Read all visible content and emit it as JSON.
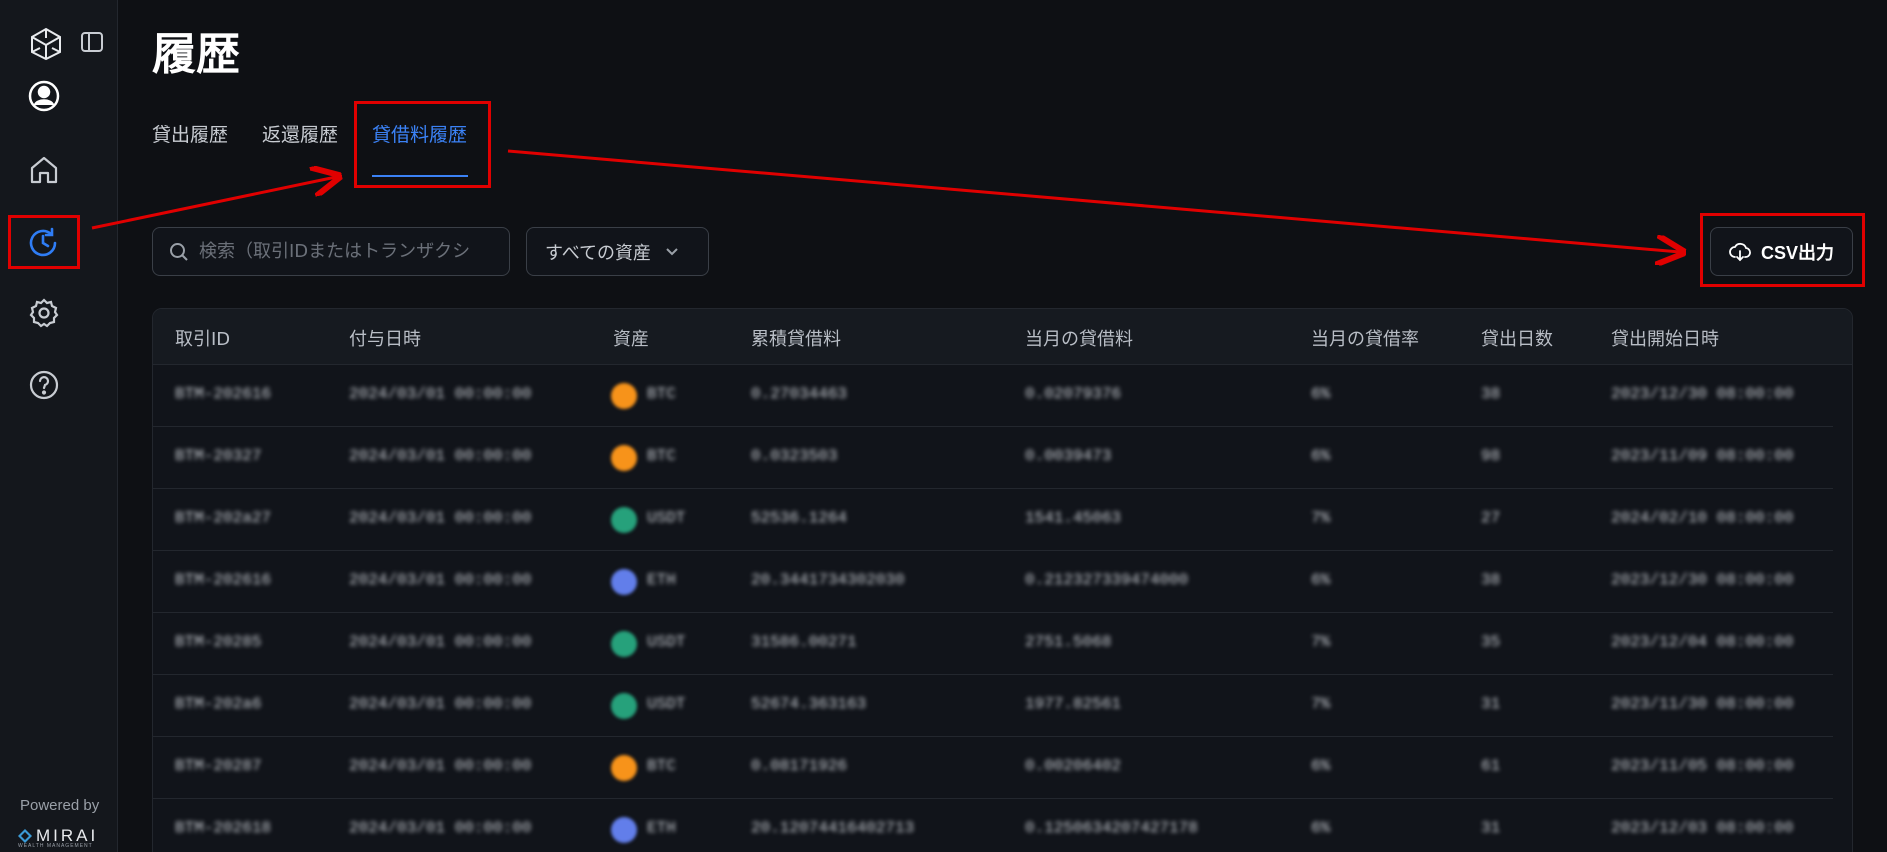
{
  "sidebar": {
    "powered_by": "Powered by",
    "brand": "MIRAI",
    "brand_sub": "WEALTH MANAGEMENT"
  },
  "page": {
    "title": "履歴"
  },
  "tabs": [
    {
      "label": "貸出履歴",
      "active": false
    },
    {
      "label": "返還履歴",
      "active": false
    },
    {
      "label": "貸借料履歴",
      "active": true
    }
  ],
  "search": {
    "placeholder": "検索（取引IDまたはトランザクシ"
  },
  "asset_filter": {
    "selected": "すべての資産"
  },
  "csv_button": {
    "label": "CSV出力"
  },
  "table": {
    "headers": [
      "取引ID",
      "付与日時",
      "資産",
      "累積貸借料",
      "当月の貸借料",
      "当月の貸借率",
      "貸出日数",
      "貸出開始日時"
    ],
    "rows": [
      {
        "id": "BTM-202616",
        "date": "2024/03/01 00:00:00",
        "asset": "BTC",
        "coin_color": "#f7931a",
        "cumulative": "0.27034463",
        "monthly": "0.02079376",
        "rate": "6%",
        "days": "38",
        "start": "2023/12/30 08:00:00"
      },
      {
        "id": "BTM-20327",
        "date": "2024/03/01 00:00:00",
        "asset": "BTC",
        "coin_color": "#f7931a",
        "cumulative": "0.0323503",
        "monthly": "0.0039473",
        "rate": "6%",
        "days": "98",
        "start": "2023/11/09 08:00:00"
      },
      {
        "id": "BTM-202a27",
        "date": "2024/03/01 00:00:00",
        "asset": "USDT",
        "coin_color": "#26a17b",
        "cumulative": "52536.1264",
        "monthly": "1541.45063",
        "rate": "7%",
        "days": "27",
        "start": "2024/02/10 08:00:00"
      },
      {
        "id": "BTM-202616",
        "date": "2024/03/01 00:00:00",
        "asset": "ETH",
        "coin_color": "#627eea",
        "cumulative": "20.3441734302030",
        "monthly": "0.212327339474000",
        "rate": "6%",
        "days": "38",
        "start": "2023/12/30 08:00:00"
      },
      {
        "id": "BTM-20285",
        "date": "2024/03/01 00:00:00",
        "asset": "USDT",
        "coin_color": "#26a17b",
        "cumulative": "31586.00271",
        "monthly": "2751.5068",
        "rate": "7%",
        "days": "35",
        "start": "2023/12/04 08:00:00"
      },
      {
        "id": "BTM-202a6",
        "date": "2024/03/01 00:00:00",
        "asset": "USDT",
        "coin_color": "#26a17b",
        "cumulative": "52674.363163",
        "monthly": "1977.82561",
        "rate": "7%",
        "days": "31",
        "start": "2023/11/30 08:00:00"
      },
      {
        "id": "BTM-20287",
        "date": "2024/03/01 00:00:00",
        "asset": "BTC",
        "coin_color": "#f7931a",
        "cumulative": "0.08171926",
        "monthly": "0.00206402",
        "rate": "6%",
        "days": "61",
        "start": "2023/11/05 08:00:00"
      },
      {
        "id": "BTM-202618",
        "date": "2024/03/01 00:00:00",
        "asset": "ETH",
        "coin_color": "#627eea",
        "cumulative": "20.12074416402713",
        "monthly": "0.1250634207427178",
        "rate": "6%",
        "days": "31",
        "start": "2023/12/03 08:00:00"
      }
    ]
  },
  "colors": {
    "accent": "#3b82f6",
    "annotation": "#e00000",
    "background": "#0e1014"
  }
}
